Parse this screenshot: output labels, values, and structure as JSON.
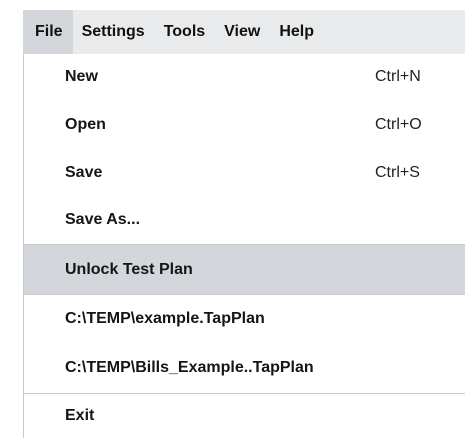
{
  "menubar": {
    "menus": [
      "File",
      "Settings",
      "Tools",
      "View",
      "Help"
    ],
    "active": "File"
  },
  "file_menu": {
    "items": [
      {
        "label": "New",
        "shortcut": "Ctrl+N"
      },
      {
        "label": "Open",
        "shortcut": "Ctrl+O"
      },
      {
        "label": "Save",
        "shortcut": "Ctrl+S"
      },
      {
        "label": "Save As...",
        "shortcut": ""
      },
      {
        "label": "Unlock Test Plan",
        "shortcut": "",
        "highlighted": true
      },
      {
        "label": "C:\\TEMP\\example.TapPlan",
        "shortcut": ""
      },
      {
        "label": "C:\\TEMP\\Bills_Example..TapPlan",
        "shortcut": ""
      },
      {
        "label": "Exit",
        "shortcut": ""
      }
    ]
  },
  "colors": {
    "menubar_bg": "#e9eaec",
    "active_bg": "#d3d7dc",
    "separator": "#c9c9c9"
  }
}
